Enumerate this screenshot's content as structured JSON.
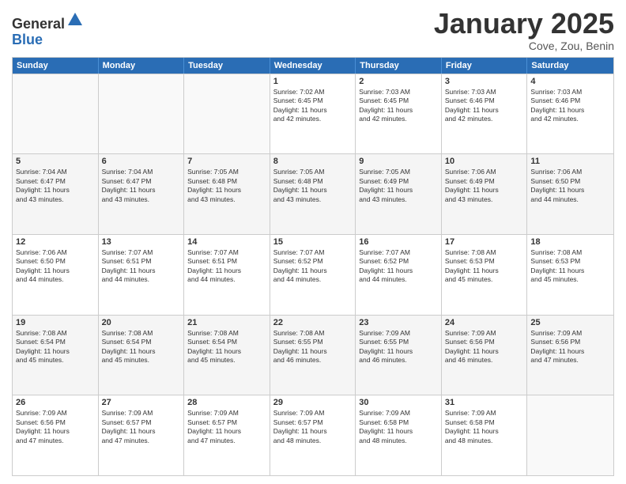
{
  "logo": {
    "general": "General",
    "blue": "Blue"
  },
  "title": "January 2025",
  "location": "Cove, Zou, Benin",
  "weekdays": [
    "Sunday",
    "Monday",
    "Tuesday",
    "Wednesday",
    "Thursday",
    "Friday",
    "Saturday"
  ],
  "rows": [
    {
      "alt": false,
      "cells": [
        {
          "day": "",
          "text": ""
        },
        {
          "day": "",
          "text": ""
        },
        {
          "day": "",
          "text": ""
        },
        {
          "day": "1",
          "text": "Sunrise: 7:02 AM\nSunset: 6:45 PM\nDaylight: 11 hours\nand 42 minutes."
        },
        {
          "day": "2",
          "text": "Sunrise: 7:03 AM\nSunset: 6:45 PM\nDaylight: 11 hours\nand 42 minutes."
        },
        {
          "day": "3",
          "text": "Sunrise: 7:03 AM\nSunset: 6:46 PM\nDaylight: 11 hours\nand 42 minutes."
        },
        {
          "day": "4",
          "text": "Sunrise: 7:03 AM\nSunset: 6:46 PM\nDaylight: 11 hours\nand 42 minutes."
        }
      ]
    },
    {
      "alt": true,
      "cells": [
        {
          "day": "5",
          "text": "Sunrise: 7:04 AM\nSunset: 6:47 PM\nDaylight: 11 hours\nand 43 minutes."
        },
        {
          "day": "6",
          "text": "Sunrise: 7:04 AM\nSunset: 6:47 PM\nDaylight: 11 hours\nand 43 minutes."
        },
        {
          "day": "7",
          "text": "Sunrise: 7:05 AM\nSunset: 6:48 PM\nDaylight: 11 hours\nand 43 minutes."
        },
        {
          "day": "8",
          "text": "Sunrise: 7:05 AM\nSunset: 6:48 PM\nDaylight: 11 hours\nand 43 minutes."
        },
        {
          "day": "9",
          "text": "Sunrise: 7:05 AM\nSunset: 6:49 PM\nDaylight: 11 hours\nand 43 minutes."
        },
        {
          "day": "10",
          "text": "Sunrise: 7:06 AM\nSunset: 6:49 PM\nDaylight: 11 hours\nand 43 minutes."
        },
        {
          "day": "11",
          "text": "Sunrise: 7:06 AM\nSunset: 6:50 PM\nDaylight: 11 hours\nand 44 minutes."
        }
      ]
    },
    {
      "alt": false,
      "cells": [
        {
          "day": "12",
          "text": "Sunrise: 7:06 AM\nSunset: 6:50 PM\nDaylight: 11 hours\nand 44 minutes."
        },
        {
          "day": "13",
          "text": "Sunrise: 7:07 AM\nSunset: 6:51 PM\nDaylight: 11 hours\nand 44 minutes."
        },
        {
          "day": "14",
          "text": "Sunrise: 7:07 AM\nSunset: 6:51 PM\nDaylight: 11 hours\nand 44 minutes."
        },
        {
          "day": "15",
          "text": "Sunrise: 7:07 AM\nSunset: 6:52 PM\nDaylight: 11 hours\nand 44 minutes."
        },
        {
          "day": "16",
          "text": "Sunrise: 7:07 AM\nSunset: 6:52 PM\nDaylight: 11 hours\nand 44 minutes."
        },
        {
          "day": "17",
          "text": "Sunrise: 7:08 AM\nSunset: 6:53 PM\nDaylight: 11 hours\nand 45 minutes."
        },
        {
          "day": "18",
          "text": "Sunrise: 7:08 AM\nSunset: 6:53 PM\nDaylight: 11 hours\nand 45 minutes."
        }
      ]
    },
    {
      "alt": true,
      "cells": [
        {
          "day": "19",
          "text": "Sunrise: 7:08 AM\nSunset: 6:54 PM\nDaylight: 11 hours\nand 45 minutes."
        },
        {
          "day": "20",
          "text": "Sunrise: 7:08 AM\nSunset: 6:54 PM\nDaylight: 11 hours\nand 45 minutes."
        },
        {
          "day": "21",
          "text": "Sunrise: 7:08 AM\nSunset: 6:54 PM\nDaylight: 11 hours\nand 45 minutes."
        },
        {
          "day": "22",
          "text": "Sunrise: 7:08 AM\nSunset: 6:55 PM\nDaylight: 11 hours\nand 46 minutes."
        },
        {
          "day": "23",
          "text": "Sunrise: 7:09 AM\nSunset: 6:55 PM\nDaylight: 11 hours\nand 46 minutes."
        },
        {
          "day": "24",
          "text": "Sunrise: 7:09 AM\nSunset: 6:56 PM\nDaylight: 11 hours\nand 46 minutes."
        },
        {
          "day": "25",
          "text": "Sunrise: 7:09 AM\nSunset: 6:56 PM\nDaylight: 11 hours\nand 47 minutes."
        }
      ]
    },
    {
      "alt": false,
      "cells": [
        {
          "day": "26",
          "text": "Sunrise: 7:09 AM\nSunset: 6:56 PM\nDaylight: 11 hours\nand 47 minutes."
        },
        {
          "day": "27",
          "text": "Sunrise: 7:09 AM\nSunset: 6:57 PM\nDaylight: 11 hours\nand 47 minutes."
        },
        {
          "day": "28",
          "text": "Sunrise: 7:09 AM\nSunset: 6:57 PM\nDaylight: 11 hours\nand 47 minutes."
        },
        {
          "day": "29",
          "text": "Sunrise: 7:09 AM\nSunset: 6:57 PM\nDaylight: 11 hours\nand 48 minutes."
        },
        {
          "day": "30",
          "text": "Sunrise: 7:09 AM\nSunset: 6:58 PM\nDaylight: 11 hours\nand 48 minutes."
        },
        {
          "day": "31",
          "text": "Sunrise: 7:09 AM\nSunset: 6:58 PM\nDaylight: 11 hours\nand 48 minutes."
        },
        {
          "day": "",
          "text": ""
        }
      ]
    }
  ]
}
